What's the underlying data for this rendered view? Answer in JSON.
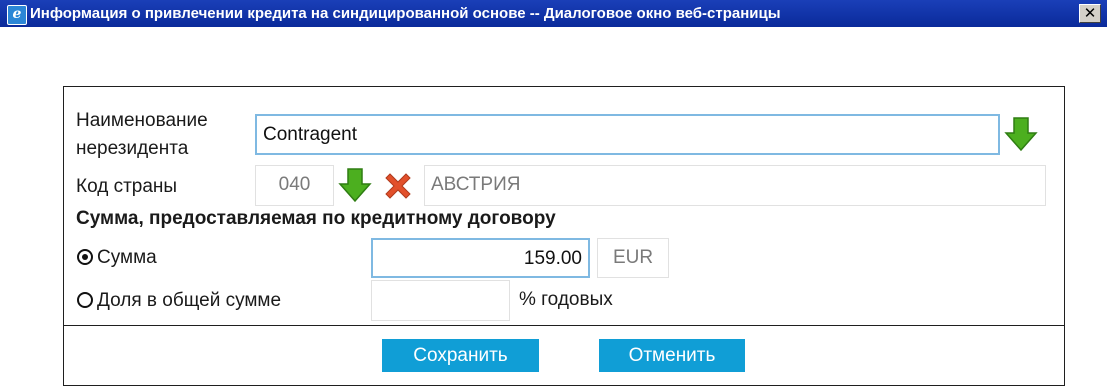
{
  "window": {
    "title": "Информация о привлечении кредита на синдицированной основе -- Диалоговое окно веб-страницы",
    "app_icon_glyph": "e",
    "close_glyph": "✕"
  },
  "form": {
    "nonresident_label_line1": "Наименование",
    "nonresident_label_line2": "нерезидента",
    "nonresident_value": "Contragent",
    "country_code_label": "Код страны",
    "country_code_value": "040",
    "country_name_value": "АВСТРИЯ",
    "sum_section_title": "Сумма, предоставляемая по кредитному договору",
    "sum_option_label": "Сумма",
    "sum_option_selected": true,
    "sum_value": "159.00",
    "currency": "EUR",
    "share_option_label": "Доля в общей сумме",
    "share_option_selected": false,
    "share_value": "",
    "share_suffix": "% годовых"
  },
  "buttons": {
    "save_label": "Сохранить",
    "cancel_label": "Отменить"
  },
  "colors": {
    "titlebar": "#0a2a9a",
    "button": "#109ed6",
    "arrow": "#4caf1f",
    "delete_x": "#e2502b",
    "active_border": "#7fb9e2"
  },
  "icons": {
    "select_arrow": "green-down-arrow-icon",
    "delete": "red-x-icon",
    "app": "ie-icon",
    "close": "close-icon"
  }
}
